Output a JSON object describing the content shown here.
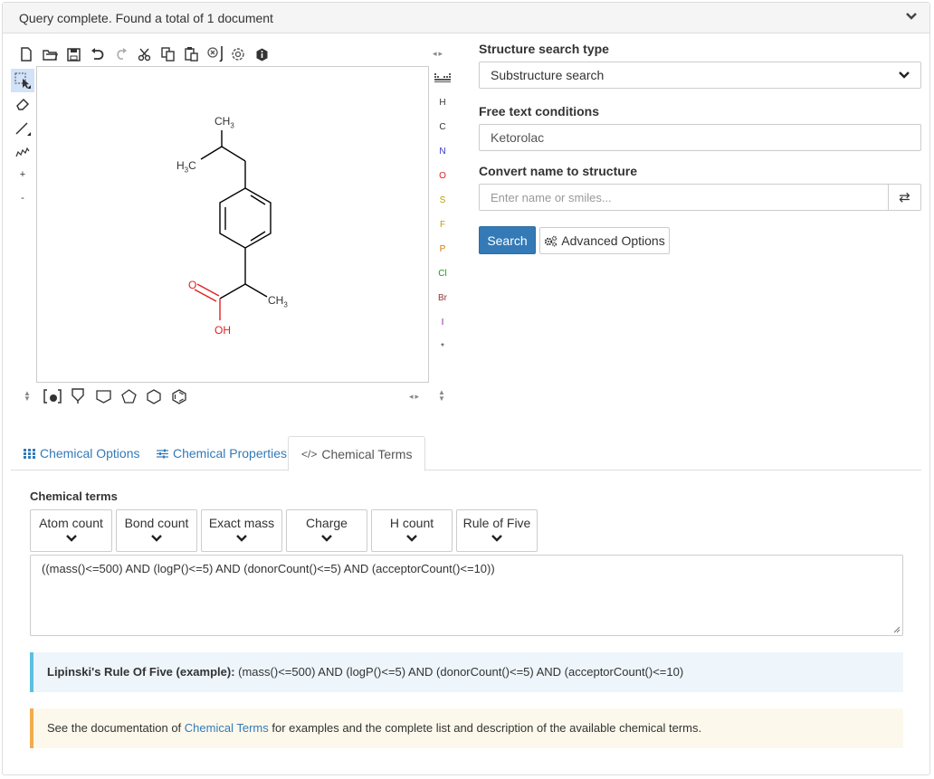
{
  "status": {
    "message": "Query complete. Found a total of 1 document"
  },
  "editor": {
    "elements": [
      {
        "symbol": "H",
        "color": "#333333"
      },
      {
        "symbol": "C",
        "color": "#333333"
      },
      {
        "symbol": "N",
        "color": "#3333cc"
      },
      {
        "symbol": "O",
        "color": "#e02020"
      },
      {
        "symbol": "S",
        "color": "#b8a000"
      },
      {
        "symbol": "F",
        "color": "#c89a00"
      },
      {
        "symbol": "P",
        "color": "#d07800"
      },
      {
        "symbol": "Cl",
        "color": "#1a9a1a"
      },
      {
        "symbol": "Br",
        "color": "#9a3333"
      },
      {
        "symbol": "I",
        "color": "#8a2a9a"
      },
      {
        "symbol": "*",
        "color": "#333333"
      }
    ],
    "charge_plus": "+",
    "charge_minus": "-",
    "molecule_labels": {
      "ch3_top": "CH",
      "ch3_top_sub": "3",
      "h3c": "H",
      "h3c_sub": "3",
      "h3c_tail": "C",
      "o_label": "O",
      "oh_label": "OH",
      "ch3_right": "CH",
      "ch3_right_sub": "3"
    }
  },
  "form": {
    "search_type_label": "Structure search type",
    "search_type_value": "Substructure search",
    "free_text_label": "Free text conditions",
    "free_text_value": "Ketorolac",
    "convert_label": "Convert name to structure",
    "convert_placeholder": "Enter name or smiles...",
    "search_button": "Search",
    "advanced_button": "Advanced Options"
  },
  "tabs": [
    {
      "label": "Chemical Options",
      "icon": "grid-icon"
    },
    {
      "label": "Chemical Properties",
      "icon": "sliders-icon"
    },
    {
      "label": "Chemical Terms",
      "icon": "code-icon",
      "active": true
    }
  ],
  "chemical_terms": {
    "title": "Chemical terms",
    "buttons": [
      "Atom count",
      "Bond count",
      "Exact mass",
      "Charge",
      "H count",
      "Rule of Five"
    ],
    "expression": "((mass()<=500) AND (logP()<=5) AND (donorCount()<=5) AND (acceptorCount()<=10))",
    "info_label": "Lipinski's Rule Of Five (example):",
    "info_text": " (mass()<=500) AND (logP()<=5) AND (donorCount()<=5) AND (acceptorCount()<=10)",
    "doc_prefix": "See the documentation of ",
    "doc_link": "Chemical Terms",
    "doc_suffix": " for examples and the complete list and description of the available chemical terms."
  }
}
